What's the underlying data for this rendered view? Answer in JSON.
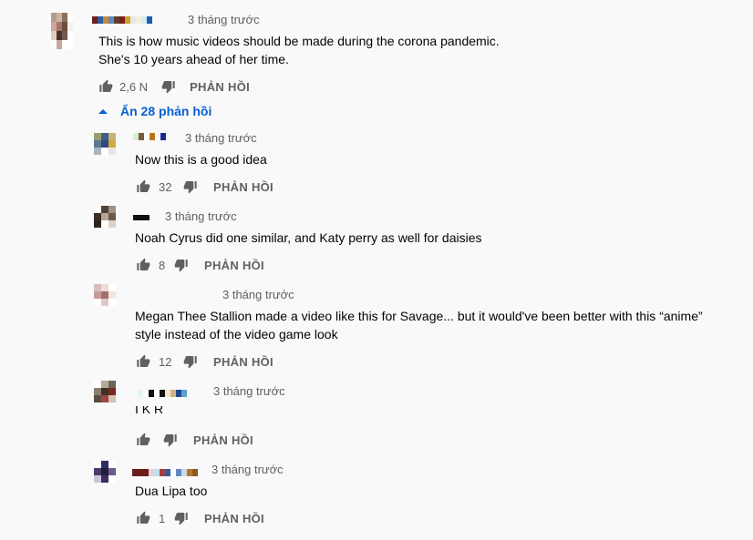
{
  "comments": [
    {
      "time": "3 tháng trước",
      "lines": [
        "This is how music videos should be made during the corona pandemic.",
        "She's 10 years ahead of her time."
      ],
      "likes": "2,6 N",
      "reply": "PHẢN HỒI",
      "avatar_colors": [
        "#b49b8c",
        "#cdb4a5",
        "#8c6e5f",
        "#ffffff",
        "#d2a596",
        "#a0786e",
        "#6e4b3c",
        "#f5f0eb",
        "#e1cdbe",
        "#4b3228",
        "#735a50",
        "#ffffff",
        "#ffffff",
        "#c3aa9b",
        "#ffffff",
        "#ffffff"
      ],
      "name_colors": [
        "#6b1d1d",
        "#2a5ea8",
        "#c98b2e",
        "#5f88c0",
        "#5d3e2a",
        "#7a1f1f",
        "#c9a227",
        "#e6e6e6",
        "#f1efe0",
        "#d8ecf5",
        "#1a5ea8"
      ]
    }
  ],
  "toggle_label": "Ẩn 28 phản hồi",
  "replies": [
    {
      "time": "3 tháng trước",
      "lines": [
        "Now this is a good idea"
      ],
      "likes": "32",
      "reply": "PHẢN HỒI",
      "avatar_colors": [
        "#96a06e",
        "#3c5f8c",
        "#c8b478",
        "#5a7896",
        "#2d4b82",
        "#d2aa3c",
        "#aab4be",
        "#ffffff",
        "#e6e6e6"
      ],
      "name_colors": [
        "#d6efd6",
        "#7a5b3c",
        "#ffffff",
        "#b8761e",
        "#ffffff",
        "#1a2c8a"
      ]
    },
    {
      "time": "3 tháng trước",
      "lines": [
        "Noah Cyrus did one similar, and Katy perry as well for daisies"
      ],
      "likes": "8",
      "reply": "PHẢN HỒI",
      "avatar_colors": [
        "#ffffff",
        "#504137",
        "#a09182",
        "#3c2d23",
        "#b4a596",
        "#695a4b",
        "#2d231e",
        "#ffffff",
        "#dcd2c8"
      ],
      "name_colors": [
        "#111111",
        "#111111",
        "#111111"
      ]
    },
    {
      "time": "3 tháng trước",
      "lines": [
        "Megan Thee Stallion made a video like this for Savage... but it would've been better with this “anime”",
        "style instead of the video game look"
      ],
      "likes": "12",
      "reply": "PHẢN HỒI",
      "avatar_colors": [
        "#d7bec3",
        "#f0dcd7",
        "#ffffff",
        "#c89b96",
        "#a56e6e",
        "#f5e6dc",
        "#ffffff",
        "#e1c8c8",
        "#ffffff"
      ],
      "name_colors": []
    },
    {
      "time": "3 tháng trước",
      "lines": [
        "I K R"
      ],
      "likes": "",
      "reply": "PHẢN HỒI",
      "avatar_colors": [
        "#ffffff",
        "#b4aa96",
        "#6e645a",
        "#8c7d6e",
        "#3c3228",
        "#782823",
        "#5a4b41",
        "#a04641",
        "#d2c3b4"
      ],
      "name_colors": [
        "#e6f5f5",
        "#ffffff",
        "#111111",
        "#ffffff",
        "#111111",
        "#f5e6c8",
        "#d2b48c",
        "#1e4b8c",
        "#5aa0d2"
      ]
    },
    {
      "time": "3 tháng trước",
      "lines": [
        "Dua Lipa too"
      ],
      "likes": "1",
      "reply": "PHẢN HỒI",
      "avatar_colors": [
        "#ffffff",
        "#2d2d64",
        "#ffffff",
        "#4b3c6e",
        "#1e1e3c",
        "#6e5a8c",
        "#c8c8dc",
        "#3c2d5a",
        "#ffffff"
      ],
      "name_colors": [
        "#6b1d1d",
        "#6b1d1d",
        "#6b1d1d",
        "#e8d0d0",
        "#c0e0ec",
        "#a34040",
        "#2a5ea8",
        "#ffffff",
        "#5f88c0",
        "#d0d8e8",
        "#b07830",
        "#8a5a1e"
      ]
    }
  ]
}
